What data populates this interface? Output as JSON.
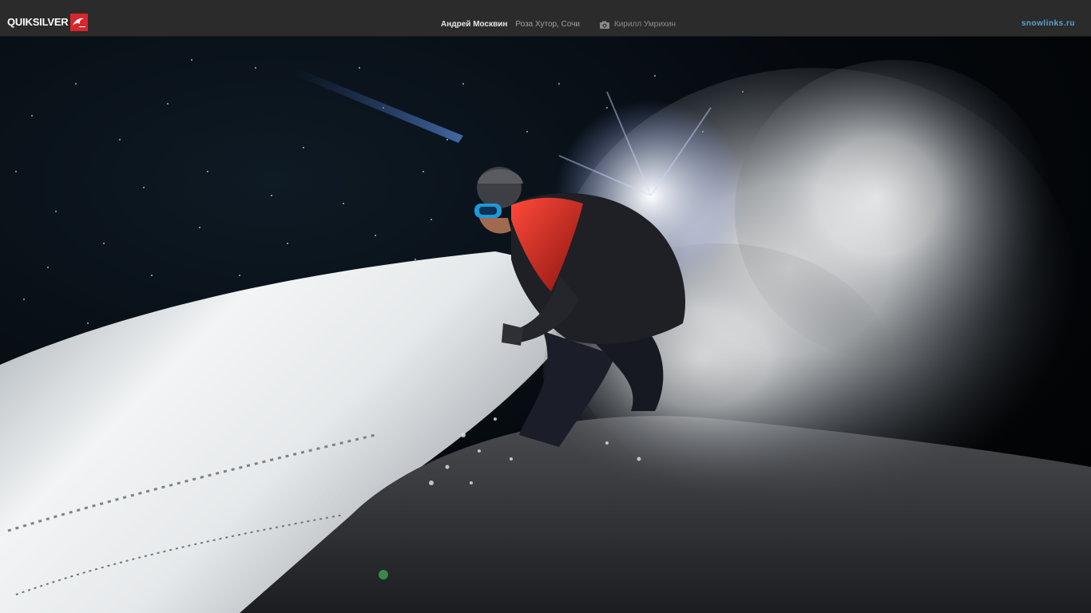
{
  "header": {
    "brand": "QUIKSILVER",
    "author": "Андрей Москвин",
    "location": "Роза Хутор, Сочи",
    "photographer": "Кирилл Умрихин",
    "site": "snowlinks.ru"
  },
  "icons": {
    "brand_logo": "quiksilver-wave-logo",
    "camera": "camera-icon"
  },
  "colors": {
    "topbar_bg": "#2b2b2b",
    "brand_red": "#d8262c",
    "site_link": "#5aa3d8"
  }
}
